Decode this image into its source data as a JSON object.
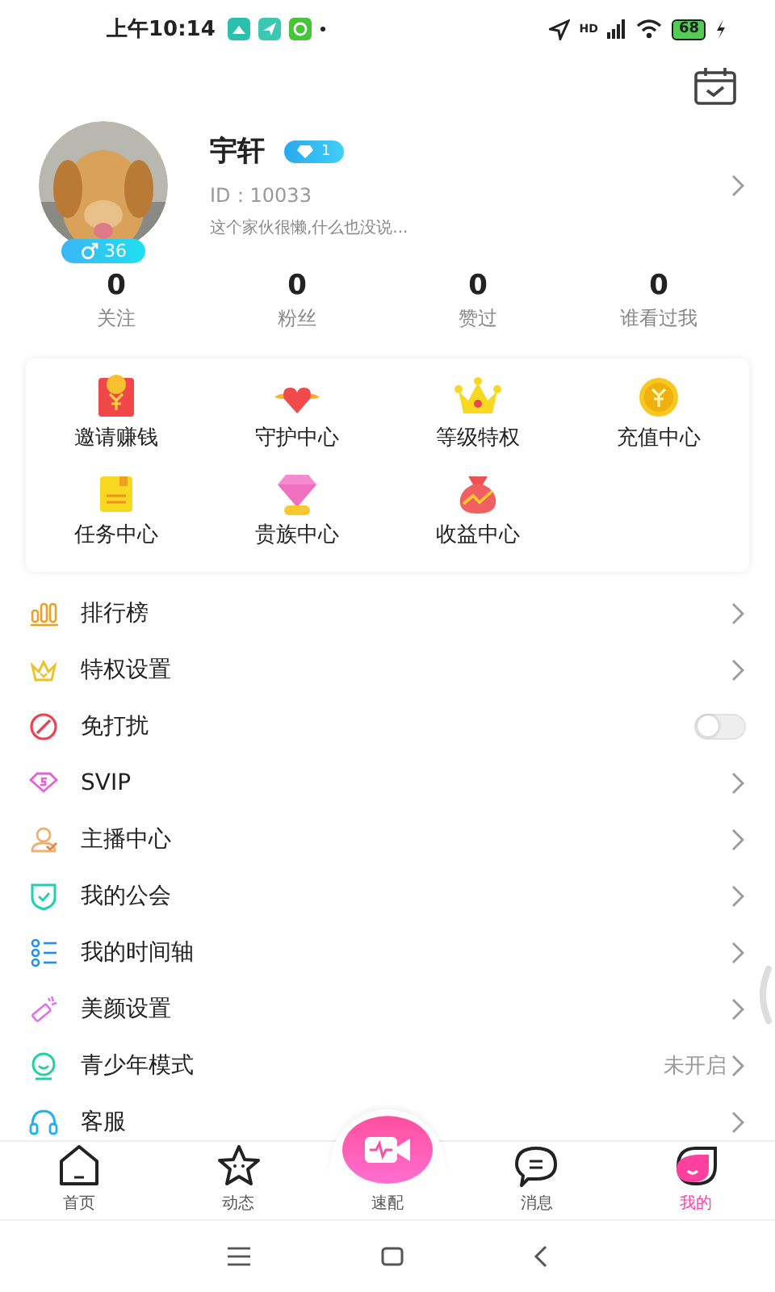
{
  "status_bar": {
    "time": "上午10:14",
    "network": "HD",
    "battery": "68"
  },
  "profile": {
    "name": "宇轩",
    "level": "1",
    "id": "ID：10033",
    "bio": "这个家伙很懒,什么也没说...",
    "age": "36"
  },
  "stats": [
    {
      "value": "0",
      "label": "关注"
    },
    {
      "value": "0",
      "label": "粉丝"
    },
    {
      "value": "0",
      "label": "赞过"
    },
    {
      "value": "0",
      "label": "谁看过我"
    }
  ],
  "features": [
    {
      "label": "邀请赚钱"
    },
    {
      "label": "守护中心"
    },
    {
      "label": "等级特权"
    },
    {
      "label": "充值中心"
    },
    {
      "label": "任务中心"
    },
    {
      "label": "贵族中心"
    },
    {
      "label": "收益中心"
    }
  ],
  "menu": [
    {
      "label": "排行榜",
      "kind": "link"
    },
    {
      "label": "特权设置",
      "kind": "link"
    },
    {
      "label": "免打扰",
      "kind": "toggle",
      "on": false
    },
    {
      "label": "SVIP",
      "kind": "link"
    },
    {
      "label": "主播中心",
      "kind": "link"
    },
    {
      "label": "我的公会",
      "kind": "link"
    },
    {
      "label": "我的时间轴",
      "kind": "link"
    },
    {
      "label": "美颜设置",
      "kind": "link"
    },
    {
      "label": "青少年模式",
      "kind": "link",
      "value": "未开启"
    },
    {
      "label": "客服",
      "kind": "link"
    }
  ],
  "tab_bar": [
    {
      "label": "首页",
      "selected": false
    },
    {
      "label": "动态",
      "selected": false
    },
    {
      "label": "速配",
      "selected": false
    },
    {
      "label": "消息",
      "selected": false
    },
    {
      "label": "我的",
      "selected": true
    }
  ]
}
